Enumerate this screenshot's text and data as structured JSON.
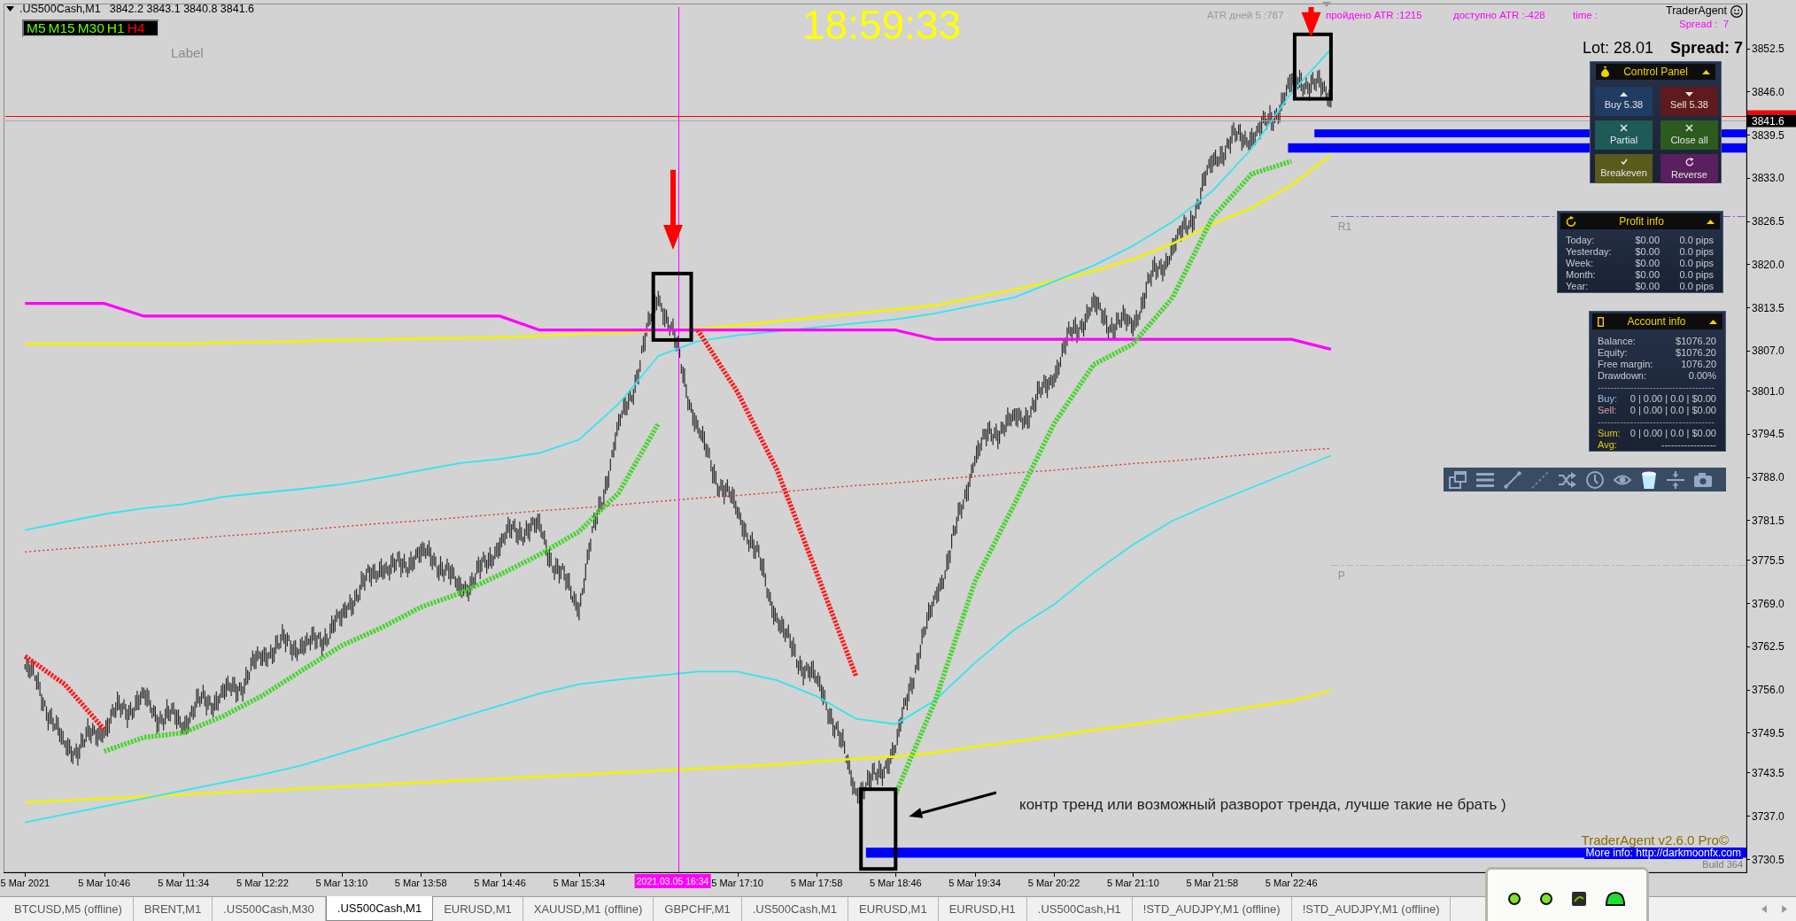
{
  "chart_window": {
    "title": ".US500Cash,M1",
    "quote": "3842.2 3843.1 3840.8 3841.6",
    "timeframes": [
      {
        "label": "M5",
        "bullish": true
      },
      {
        "label": "M15",
        "bullish": true
      },
      {
        "label": "M30",
        "bullish": true
      },
      {
        "label": "H1",
        "bullish": true
      },
      {
        "label": "H4",
        "bullish": false
      }
    ],
    "label": "Label",
    "clock": "18:59:33",
    "atr_stats": [
      {
        "text": "ATR дней 5 :787",
        "color": "#999999"
      },
      {
        "text": "пройдено ATR :1215",
        "color": "#ff00ff"
      },
      {
        "text": "доступно ATR :-428",
        "color": "#ff00ff"
      },
      {
        "text": "time :",
        "color": "#ff00ff"
      }
    ],
    "trader_agent": {
      "name": "TraderAgent",
      "spread": "Spread :  7"
    },
    "lot": "Lot: 28.01",
    "spread": "Spread: 7",
    "control_panel": {
      "title": "Control Panel",
      "buttons": [
        {
          "kind": "buy",
          "label": "Buy 5.38"
        },
        {
          "kind": "sell",
          "label": "Sell 5.38"
        },
        {
          "kind": "partial",
          "label": "Partial"
        },
        {
          "kind": "close_all",
          "label": "Close all"
        },
        {
          "kind": "breakeven",
          "label": "Breakeven"
        },
        {
          "kind": "reverse",
          "label": "Reverse"
        }
      ]
    },
    "profit_info": {
      "title": "Profit info",
      "rows": [
        {
          "period": "Today:",
          "amount": "$0.00",
          "pips": "0.0 pips"
        },
        {
          "period": "Yesterday:",
          "amount": "$0.00",
          "pips": "0.0 pips"
        },
        {
          "period": "Week:",
          "amount": "$0.00",
          "pips": "0.0 pips"
        },
        {
          "period": "Month:",
          "amount": "$0.00",
          "pips": "0.0 pips"
        },
        {
          "period": "Year:",
          "amount": "$0.00",
          "pips": "0.0 pips"
        }
      ]
    },
    "account_info": {
      "title": "Account info",
      "rows": [
        {
          "kind": "value",
          "label": "Balance:",
          "value": "$1076.20"
        },
        {
          "kind": "value",
          "label": "Equity:",
          "value": "$1076.20"
        },
        {
          "kind": "value",
          "label": "Free margin:",
          "value": "1076.20"
        },
        {
          "kind": "value",
          "label": "Drawdown:",
          "value": "0.00%"
        },
        {
          "kind": "divider",
          "text": "------------------------------------"
        },
        {
          "kind": "buy",
          "label": "Buy:",
          "value": "0 | 0.00 | 0.0 | $0.00"
        },
        {
          "kind": "sell",
          "label": "Sell:",
          "value": "0 | 0.00 | 0.0 | $0.00"
        },
        {
          "kind": "divider",
          "text": "------------------------------------"
        },
        {
          "kind": "total",
          "label": "Sum:",
          "value": "0 | 0.00 | 0.0 | $0.00"
        },
        {
          "kind": "total",
          "label": "Avg:",
          "value": "-----------------"
        }
      ]
    },
    "toolbar": [
      {
        "kind": "windows",
        "selected": false
      },
      {
        "kind": "list",
        "selected": false
      },
      {
        "kind": "line",
        "selected": false
      },
      {
        "kind": "dashed_line",
        "selected": false
      },
      {
        "kind": "shuffle",
        "selected": false
      },
      {
        "kind": "clock",
        "selected": false
      },
      {
        "kind": "eye",
        "selected": false
      },
      {
        "kind": "cup",
        "selected": true
      },
      {
        "kind": "split",
        "selected": false
      },
      {
        "kind": "camera",
        "selected": false
      }
    ],
    "drawings": [
      {
        "kind": "frame"
      },
      {
        "kind": "frame"
      },
      {
        "kind": "frame"
      },
      {
        "kind": "arrow"
      },
      {
        "kind": "arrow"
      },
      {
        "kind": "pointer"
      }
    ],
    "crosshair_label": "2021.03.05 16:34",
    "chart_data": {
      "type": "line",
      "categories": [
        "5 Mar 2021",
        null,
        "5 Mar 10:46",
        null,
        "5 Mar 11:34",
        null,
        "5 Mar 12:22",
        null,
        "5 Mar 13:10",
        null,
        "5 Mar 13:58",
        null,
        "5 Mar 14:46",
        null,
        "5 Mar 15:34",
        null,
        null,
        null,
        "5 Mar 17:10",
        null,
        "5 Mar 17:58",
        null,
        "5 Mar 18:46",
        null,
        "5 Mar 19:34",
        null,
        "5 Mar 20:22",
        null,
        "5 Mar 21:10",
        null,
        "5 Mar 21:58",
        null,
        "5 Mar 22:46",
        null,
        null,
        null,
        null,
        null,
        null,
        null,
        null,
        null,
        null,
        null
      ],
      "series": [
        {
          "color": "#f2f200",
          "values": [
            3739,
            3739.3,
            3739.6,
            3739.9,
            3740.2,
            3740.5,
            3740.8,
            3741.1,
            3741.4,
            3741.7,
            3742,
            3742.3,
            3742.6,
            3742.9,
            3743.2,
            3743.5,
            3743.8,
            3744.1,
            3744.4,
            3744.7,
            3745.2,
            3745.6,
            3745.9,
            3746.5,
            3747.4,
            3748.2,
            3749,
            3749.9,
            3750.7,
            3751.6,
            3752.5,
            3753.4,
            3754.3,
            3755.8,
            null,
            null,
            null,
            null,
            null,
            null,
            null,
            null,
            null,
            null
          ]
        },
        {
          "color": "#f2f200",
          "values": [
            3808,
            3808,
            3808,
            3808,
            3808,
            3808.2,
            3808.3,
            3808.4,
            3808.6,
            3808.7,
            3808.8,
            3808.9,
            3809,
            3809.2,
            3809.5,
            3809.7,
            3810,
            3810.3,
            3810.8,
            3811.4,
            3812,
            3812.6,
            3813.2,
            3813.8,
            3815,
            3816.2,
            3817.5,
            3819,
            3820.8,
            3823.1,
            3826,
            3828.5,
            3831.9,
            3836.4,
            null,
            null,
            null,
            null,
            null,
            null,
            null,
            null,
            null,
            null
          ]
        },
        {
          "color": "#33e4f2",
          "values": [
            3736,
            3737.2,
            3738.4,
            3739.6,
            3740.8,
            3742,
            3743.2,
            3744.6,
            3746.4,
            3748.2,
            3750,
            3751.8,
            3753.6,
            3755.4,
            3756.8,
            3757.5,
            3758.1,
            3758.7,
            3758.7,
            3757.4,
            3755,
            3751.6,
            3750.8,
            3754.4,
            3760,
            3765,
            3768.8,
            3773.6,
            3777.8,
            3781.4,
            3784,
            3786.4,
            3788.8,
            3791.2,
            null,
            null,
            null,
            null,
            null,
            null,
            null,
            null,
            null,
            null
          ]
        },
        {
          "color": "#33e4f2",
          "values": [
            3780,
            3781.2,
            3782.4,
            3783.3,
            3783.9,
            3785,
            3785.6,
            3786.2,
            3786.9,
            3787.9,
            3789,
            3790.1,
            3790.7,
            3791.6,
            3793.6,
            3799,
            3806.2,
            3808.4,
            3809.3,
            3809.9,
            3810.5,
            3811.1,
            3811.7,
            3812.6,
            3813.8,
            3815,
            3817.4,
            3819.8,
            3822.8,
            3826.4,
            3831,
            3837.4,
            3845.8,
            3852.4,
            null,
            null,
            null,
            null,
            null,
            null,
            null,
            null,
            null,
            null
          ]
        },
        {
          "color": "#e03030",
          "line_style": "dotted",
          "values": [
            3776.7,
            3777.2,
            3777.6,
            3778.1,
            3778.6,
            3779.1,
            3779.5,
            3780,
            3780.5,
            3781,
            3781.4,
            3781.9,
            3782.4,
            3782.9,
            3783.3,
            3783.8,
            3784.3,
            3784.8,
            3785.2,
            3785.7,
            3786.2,
            3786.7,
            3787.1,
            3787.6,
            3788.1,
            3788.6,
            3789,
            3789.5,
            3790,
            3790.4,
            3790.9,
            3791.4,
            3791.9,
            3792.3,
            null,
            null,
            null,
            null,
            null,
            null,
            null,
            null,
            null,
            null
          ]
        },
        {
          "color": "#ff00ff",
          "values": [
            3814.1,
            3814.1,
            3814.1,
            3812.2,
            3812.2,
            3812.2,
            3812.2,
            3812.2,
            3812.2,
            3812.2,
            3812.2,
            3812.2,
            3812.2,
            3810.1,
            3810.1,
            3810.1,
            3810.1,
            3810.1,
            3810.1,
            3810.1,
            3810.1,
            3810.1,
            3810.1,
            3808.7,
            3808.7,
            3808.7,
            3808.7,
            3808.7,
            3808.7,
            3808.7,
            3808.7,
            3808.7,
            3808.7,
            3807.2,
            null,
            null,
            null,
            null,
            null,
            null,
            null,
            null,
            null,
            null
          ]
        },
        {
          "color": "#46d42c",
          "line_style": "dashed",
          "values": [
            null,
            null,
            3746.7,
            3748.8,
            3749.5,
            3752,
            3755.1,
            3758.9,
            3762.6,
            3765.3,
            3768.4,
            3770.5,
            3773.3,
            3776.3,
            3779.8,
            3785.6,
            3796,
            null,
            null,
            null,
            null,
            null,
            3740.3,
            3754.3,
            3772.2,
            3783.9,
            3796,
            3804.9,
            3808,
            3815,
            3827,
            3833.6,
            3835.5,
            null,
            null,
            null,
            null,
            null,
            null,
            null,
            null,
            null,
            null,
            null
          ]
        },
        {
          "color": "#ff1a1a",
          "line_style": "dashed",
          "values": [
            3761,
            3756.8,
            3750,
            null,
            null,
            null,
            null,
            null,
            null,
            null,
            null,
            null,
            null,
            null,
            null,
            null,
            null,
            3810.1,
            3800.8,
            3789.1,
            3773.6,
            3758,
            null,
            null,
            null,
            null,
            null,
            null,
            null,
            null,
            null,
            null,
            null,
            null,
            null,
            null,
            null,
            null,
            null,
            null,
            null,
            null,
            null,
            null
          ]
        }
      ],
      "ylim": [
        3728.5,
        3858.7
      ],
      "yticks": [
        {
          "value": 3852.5,
          "label": "3852.5"
        },
        {
          "value": 3846,
          "label": "3846.0"
        },
        {
          "value": 3839.5,
          "label": "3839.5"
        },
        {
          "value": 3833,
          "label": "3833.0"
        },
        {
          "value": 3826.5,
          "label": "3826.5"
        },
        {
          "value": 3820,
          "label": "3820.0"
        },
        {
          "value": 3813.5,
          "label": "3813.5"
        },
        {
          "value": 3807,
          "label": "3807.0"
        },
        {
          "value": 3801,
          "label": "3801.0"
        },
        {
          "value": 3794.5,
          "label": "3794.5"
        },
        {
          "value": 3788,
          "label": "3788.0"
        },
        {
          "value": 3781.5,
          "label": "3781.5"
        },
        {
          "value": 3775.5,
          "label": "3775.5"
        },
        {
          "value": 3769,
          "label": "3769.0"
        },
        {
          "value": 3762.5,
          "label": "3762.5"
        },
        {
          "value": 3756,
          "label": "3756.0"
        },
        {
          "value": 3749.5,
          "label": "3749.5"
        },
        {
          "value": 3743.5,
          "label": "3743.5"
        },
        {
          "value": 3737,
          "label": "3737.0"
        },
        {
          "value": 3730.5,
          "label": "3730.5"
        }
      ],
      "ref_lines": [
        {
          "axis": "y",
          "value": 3827.2,
          "label": "R1",
          "color": "#9b4fe0"
        },
        {
          "axis": "y",
          "value": 3774.8,
          "label": "P",
          "color": "#b4b4b4"
        },
        {
          "axis": "y",
          "value": 3842.3,
          "color": "#ff0000"
        },
        {
          "axis": "y",
          "value": 3841.6,
          "label": "3841.6",
          "color": "#a8a8a8"
        }
      ],
      "bands": [
        {
          "axis": "y",
          "from": 3839.1,
          "to": 3840.3,
          "color": "#0000ff"
        },
        {
          "axis": "y",
          "from": 3836.8,
          "to": 3838.2,
          "color": "#0000ff"
        },
        {
          "axis": "y",
          "from": 3730.7,
          "to": 3732.2,
          "color": "#0000ff"
        }
      ],
      "annotations": [
        "контр тренд или возможный разворот тренда, лучше такие не брать )"
      ]
    },
    "footer": {
      "product": "TraderAgent v2.6.0 Pro©",
      "info": "More info: http://darkmoonfx.com",
      "build": "Build 364"
    }
  },
  "tabs": [
    {
      "label": "BTCUSD,M5 (offline)",
      "selected": false
    },
    {
      "label": "BRENT,M1",
      "selected": false
    },
    {
      "label": ".US500Cash,M30",
      "selected": false
    },
    {
      "label": ".US500Cash,M1",
      "selected": true
    },
    {
      "label": "EURUSD,M1",
      "selected": false
    },
    {
      "label": "XAUUSD,M1 (offline)",
      "selected": false
    },
    {
      "label": "GBPCHF,M1",
      "selected": false
    },
    {
      "label": ".US500Cash,M1",
      "selected": false
    },
    {
      "label": "EURUSD,M1",
      "selected": false
    },
    {
      "label": "EURUSD,H1",
      "selected": false
    },
    {
      "label": ".US500Cash,H1",
      "selected": false
    },
    {
      "label": "!STD_AUDJPY,M1 (offline)",
      "selected": false
    },
    {
      "label": "!STD_AUDJPY,M1 (offline)",
      "selected": false
    }
  ]
}
